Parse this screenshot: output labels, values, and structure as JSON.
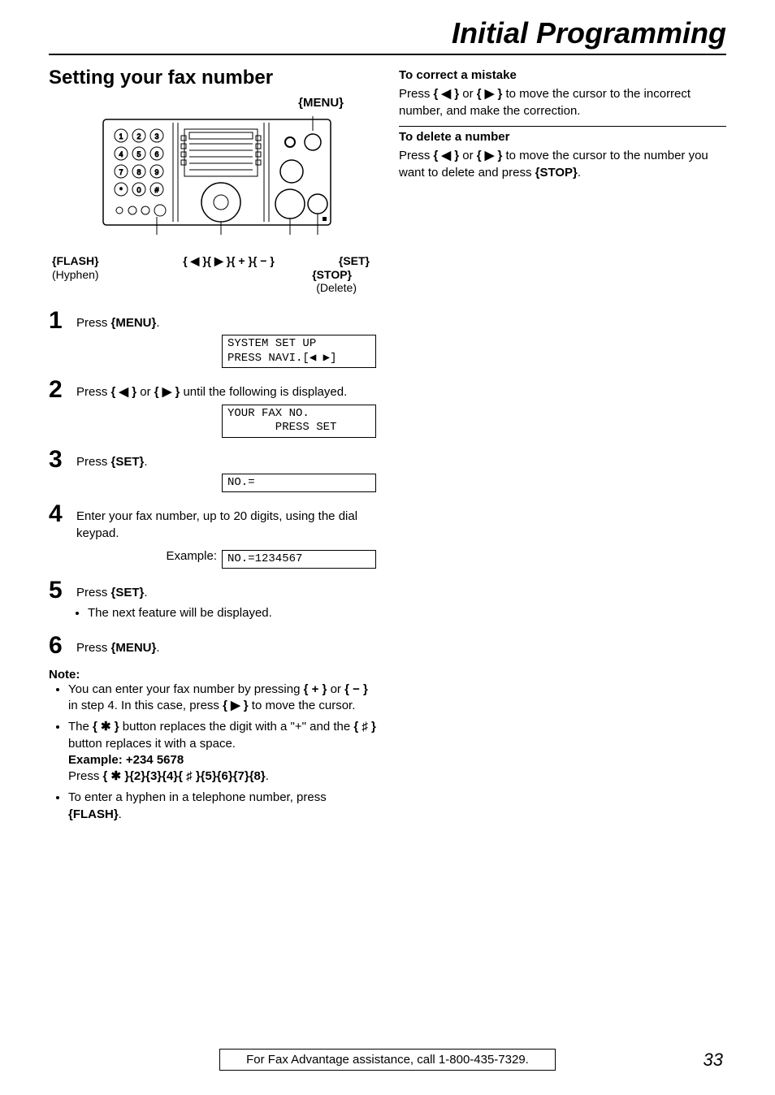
{
  "document_title": "Initial Programming",
  "section_title": "Setting your fax number",
  "diagram": {
    "menu_label": "{MENU}",
    "flash_label": "{FLASH}",
    "flash_sub": "(Hyphen)",
    "nav_label": "{ ◀ }{ ▶ }{ + }{ − }",
    "set_label": "{SET}",
    "stop_label": "{STOP}",
    "stop_sub": "(Delete)"
  },
  "steps": [
    {
      "num": "1",
      "text_parts": [
        "Press ",
        "{MENU}",
        "."
      ],
      "display": "SYSTEM SET UP\nPRESS NAVI.[◀ ▶]"
    },
    {
      "num": "2",
      "text_parts": [
        "Press ",
        "{ ◀ }",
        " or ",
        "{ ▶ }",
        " until the following is displayed."
      ],
      "display": "YOUR FAX NO.\n       PRESS SET"
    },
    {
      "num": "3",
      "text_parts": [
        "Press ",
        "{SET}",
        "."
      ],
      "display": "NO.="
    },
    {
      "num": "4",
      "text_parts": [
        "Enter your fax number, up to 20 digits, using the dial keypad."
      ],
      "example_label": "Example:",
      "display": "NO.=1234567"
    },
    {
      "num": "5",
      "text_parts": [
        "Press ",
        "{SET}",
        "."
      ],
      "bullets": [
        "The next feature will be displayed."
      ]
    },
    {
      "num": "6",
      "text_parts": [
        "Press ",
        "{MENU}",
        "."
      ]
    }
  ],
  "note_heading": "Note:",
  "notes": [
    {
      "parts": [
        "You can enter your fax number by pressing ",
        "{ + }",
        " or ",
        "{ − }",
        " in step 4. In this case, press ",
        "{ ▶ }",
        " to move the cursor."
      ]
    },
    {
      "parts": [
        "The ",
        "{ ✱ }",
        " button replaces the digit with a \"+\" and the ",
        "{ ♯ }",
        " button replaces it with a space."
      ],
      "example_label": "Example: +234 5678",
      "example_parts": [
        "Press ",
        "{ ✱ }{2}{3}{4}{ ♯ }{5}{6}{7}{8}",
        "."
      ]
    },
    {
      "parts": [
        "To enter a hyphen in a telephone number, press ",
        "{FLASH}",
        "."
      ]
    }
  ],
  "right_column": {
    "correct_heading": "To correct a mistake",
    "correct_parts": [
      "Press ",
      "{ ◀ }",
      " or ",
      "{ ▶ }",
      " to move the cursor to the incorrect number, and make the correction."
    ],
    "delete_heading": "To delete a number",
    "delete_parts": [
      "Press ",
      "{ ◀ }",
      " or ",
      "{ ▶ }",
      " to move the cursor to the number you want to delete and press ",
      "{STOP}",
      "."
    ]
  },
  "footer_text": "For Fax Advantage assistance, call 1-800-435-7329.",
  "page_number": "33"
}
